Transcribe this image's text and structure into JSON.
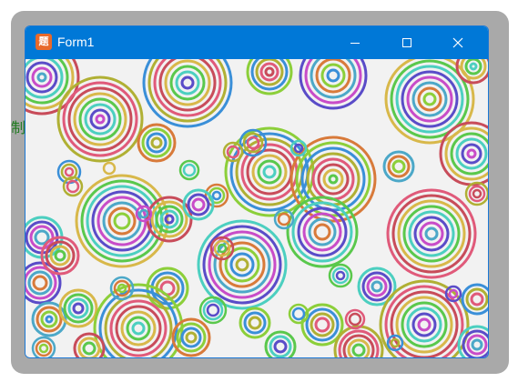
{
  "background_text": "制",
  "window": {
    "title": "Form1",
    "icon": "app-icon",
    "icon_glyph": "题",
    "titlebar_color": "#0078d7",
    "controls": {
      "minimize": "minimize-icon",
      "maximize": "maximize-icon",
      "close": "close-icon"
    }
  },
  "canvas": {
    "background": "#f2f2f2",
    "palette": [
      "#c84c5a",
      "#d8b84a",
      "#5ac84c",
      "#4ccfc0",
      "#5a4cc8",
      "#c84cc8",
      "#4ca8c8",
      "#d87a3a",
      "#8ccf3a",
      "#3a8fd8",
      "#b0b034",
      "#e05a7a"
    ]
  }
}
